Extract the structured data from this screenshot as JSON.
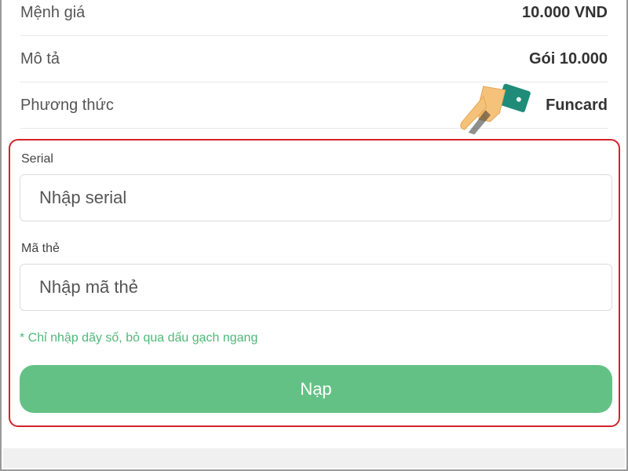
{
  "info": {
    "rows": [
      {
        "label": "Mệnh giá",
        "value": "10.000 VND"
      },
      {
        "label": "Mô tả",
        "value": "Gói 10.000"
      },
      {
        "label": "Phương thức",
        "value": "Funcard"
      }
    ]
  },
  "form": {
    "serial_label": "Serial",
    "serial_placeholder": "Nhập serial",
    "code_label": "Mã thẻ",
    "code_placeholder": "Nhập mã thẻ",
    "hint": "* Chỉ nhập dãy số, bỏ qua dấu gạch ngang",
    "submit_label": "Nạp"
  },
  "colors": {
    "highlight_border": "#d2232a",
    "button": "#64c185",
    "hint_text": "#4fb878"
  },
  "icons": {
    "pointer": "pointing-hand-icon"
  }
}
